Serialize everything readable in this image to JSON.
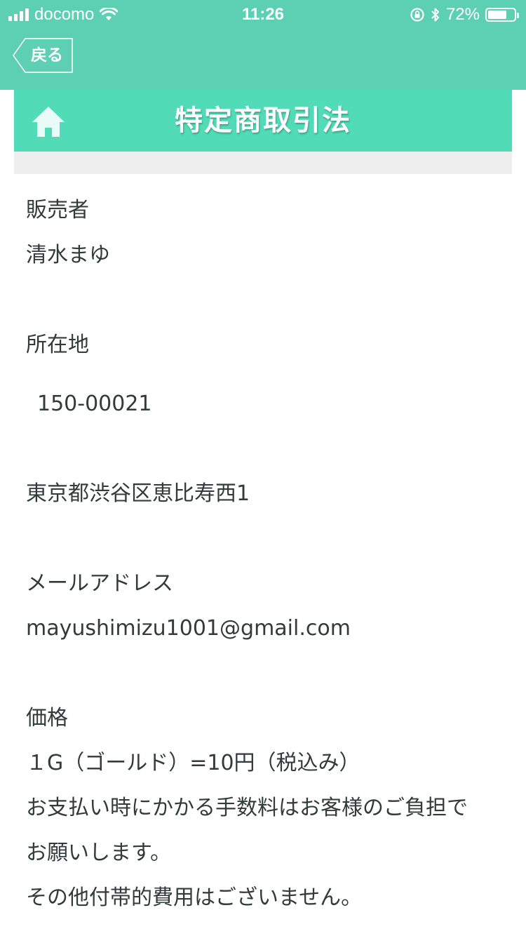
{
  "status_bar": {
    "carrier": "docomo",
    "time": "11:26",
    "battery_percent": "72%",
    "battery_level": 0.72
  },
  "nav": {
    "back_label": "戻る"
  },
  "header": {
    "title": "特定商取引法",
    "home_icon": "home-icon"
  },
  "sections": {
    "seller": {
      "label": "販売者",
      "value": "清水まゆ"
    },
    "address": {
      "label": "所在地",
      "postal": "150-00021",
      "street": "東京都渋谷区恵比寿西1"
    },
    "email": {
      "label": "メールアドレス",
      "value": "mayushimizu1001@gmail.com"
    },
    "price": {
      "label": "価格",
      "line1": "１G（ゴールド）=10円（税込み）",
      "line2": "お支払い時にかかる手数料はお客様のご負担で",
      "line3": "お願いします。",
      "line4": "その他付帯的費用はございません。"
    }
  },
  "colors": {
    "topbar": "#5dd0b3",
    "header": "#52dbb7",
    "text": "#333b3a",
    "band": "#eeeeee"
  }
}
